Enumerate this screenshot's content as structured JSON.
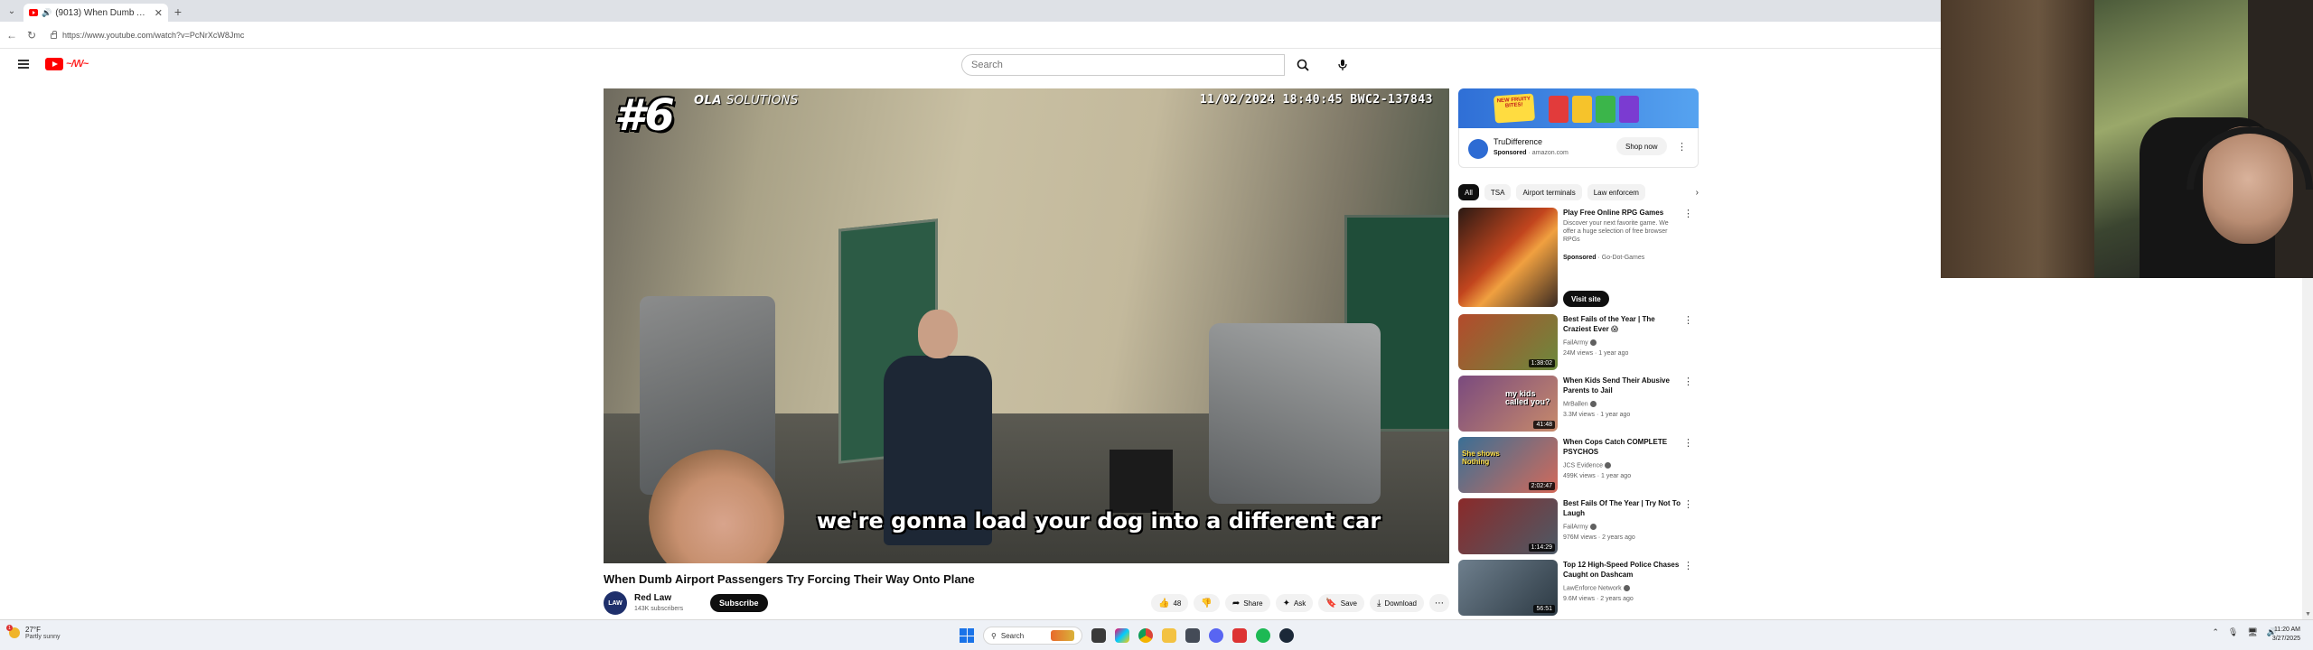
{
  "browser": {
    "tab_title": "(9013) When Dumb Airport P",
    "url": "https://www.youtube.com/watch?v=PcNrXcW8Jmc"
  },
  "youtube": {
    "search_placeholder": "Search"
  },
  "player": {
    "rank_overlay": "#6",
    "brand_overlay_bold": "OLA",
    "brand_overlay_light": "SOLUTIONS",
    "timestamp_overlay": "11/02/2024 18:40:45 BWC2-137843",
    "caption_overlay": "we're gonna load your dog into a different car"
  },
  "video": {
    "title": "When Dumb Airport Passengers Try Forcing Their Way Onto Plane",
    "channel_name": "Red Law",
    "channel_subs": "143K subscribers",
    "avatar_text": "LAW",
    "subscribe_label": "Subscribe",
    "like_count": "48",
    "share_label": "Share",
    "ask_label": "Ask",
    "save_label": "Save",
    "download_label": "Download"
  },
  "ad": {
    "banner_text": "NEW FRUITY BITES!",
    "advertiser": "TruDifference",
    "sponsored_label": "Sponsored",
    "domain": "amazon.com",
    "shop_label": "Shop now"
  },
  "chips": [
    "All",
    "TSA",
    "Airport terminals",
    "Law enforcem"
  ],
  "sponsored_rec": {
    "title": "Play Free Online RPG Games",
    "description": "Discover your next favorite game. We offer a huge selection of free browser RPGs",
    "sponsored_label": "Sponsored",
    "advertiser": "Go-Dot-Games",
    "visit_label": "Visit site"
  },
  "recommendations": [
    {
      "title": "Best Fails of the Year | The Craziest Ever 😱",
      "channel": "FailArmy",
      "meta": "24M views · 1 year ago",
      "duration": "1:38:02",
      "thumb_colors": [
        "#b44a2b",
        "#6b8a3d"
      ]
    },
    {
      "title": "When Kids Send Their Abusive Parents to Jail",
      "channel": "MrBallen",
      "meta": "3.3M views · 1 year ago",
      "duration": "41:48",
      "thumb_text": "my kids called you?",
      "thumb_colors": [
        "#7a4a7e",
        "#c78a6b"
      ]
    },
    {
      "title": "When Cops Catch COMPLETE PSYCHOS",
      "channel": "JCS Evidence",
      "meta": "499K views · 1 year ago",
      "duration": "2:02:47",
      "thumb_text": "She shows Nothing",
      "thumb_colors": [
        "#3a6f95",
        "#d46a5a"
      ]
    },
    {
      "title": "Best Fails Of The Year | Try Not To Laugh",
      "channel": "FailArmy",
      "meta": "976M views · 2 years ago",
      "duration": "1:14:29",
      "thumb_colors": [
        "#8a2a2a",
        "#4d5a66"
      ]
    },
    {
      "title": "Top 12 High-Speed Police Chases Caught on Dashcam",
      "channel": "LawEnforce Network",
      "meta": "9.6M views · 2 years ago",
      "duration": "56:51",
      "thumb_colors": [
        "#6e7f8d",
        "#2d3a44"
      ]
    }
  ],
  "taskbar": {
    "temperature": "27°F",
    "condition": "Partly sunny",
    "search_label": "Search",
    "time": "11:20 AM",
    "date": "3/27/2025"
  }
}
